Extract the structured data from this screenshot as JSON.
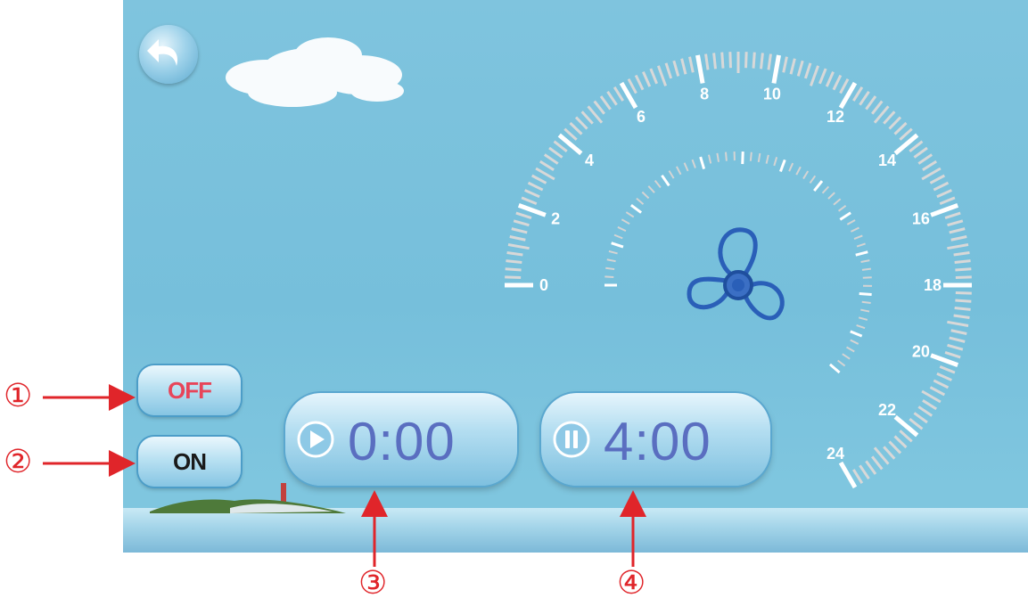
{
  "back_button": {
    "icon": "back-arrow-icon"
  },
  "buttons": {
    "off_label": "OFF",
    "on_label": "ON"
  },
  "timers": {
    "start": {
      "icon": "play-icon",
      "value": "0:00"
    },
    "pause": {
      "icon": "pause-icon",
      "value": "4:00"
    }
  },
  "gauge": {
    "icon": "fan-icon",
    "scale_labels": [
      "0",
      "2",
      "4",
      "6",
      "8",
      "10",
      "12",
      "14",
      "16",
      "18",
      "20",
      "22",
      "24"
    ],
    "min": 0,
    "max": 24
  },
  "markers": [
    "①",
    "②",
    "③",
    "④"
  ],
  "colors": {
    "accent": "#5a6ec0",
    "off": "#e7455a",
    "marker": "#e0252a",
    "fan": "#2a5fb8"
  }
}
